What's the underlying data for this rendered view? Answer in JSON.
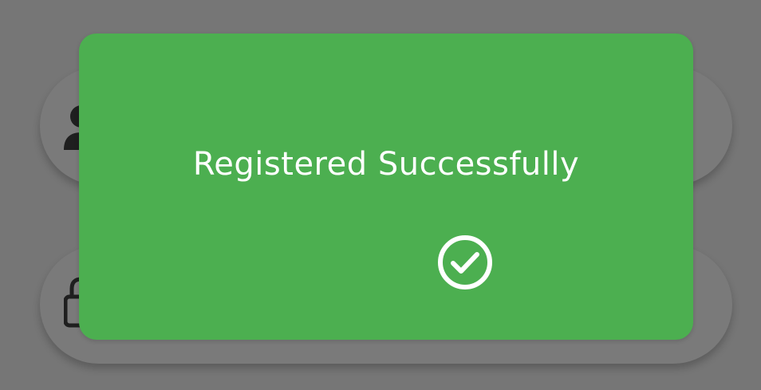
{
  "background_fields": [
    {
      "icon": "person-icon"
    },
    {
      "icon": "lock-icon"
    }
  ],
  "dialog": {
    "message": "Registered Successfully",
    "icon": "check-circle-icon",
    "background_color": "#4caf50",
    "text_color": "#ffffff"
  }
}
